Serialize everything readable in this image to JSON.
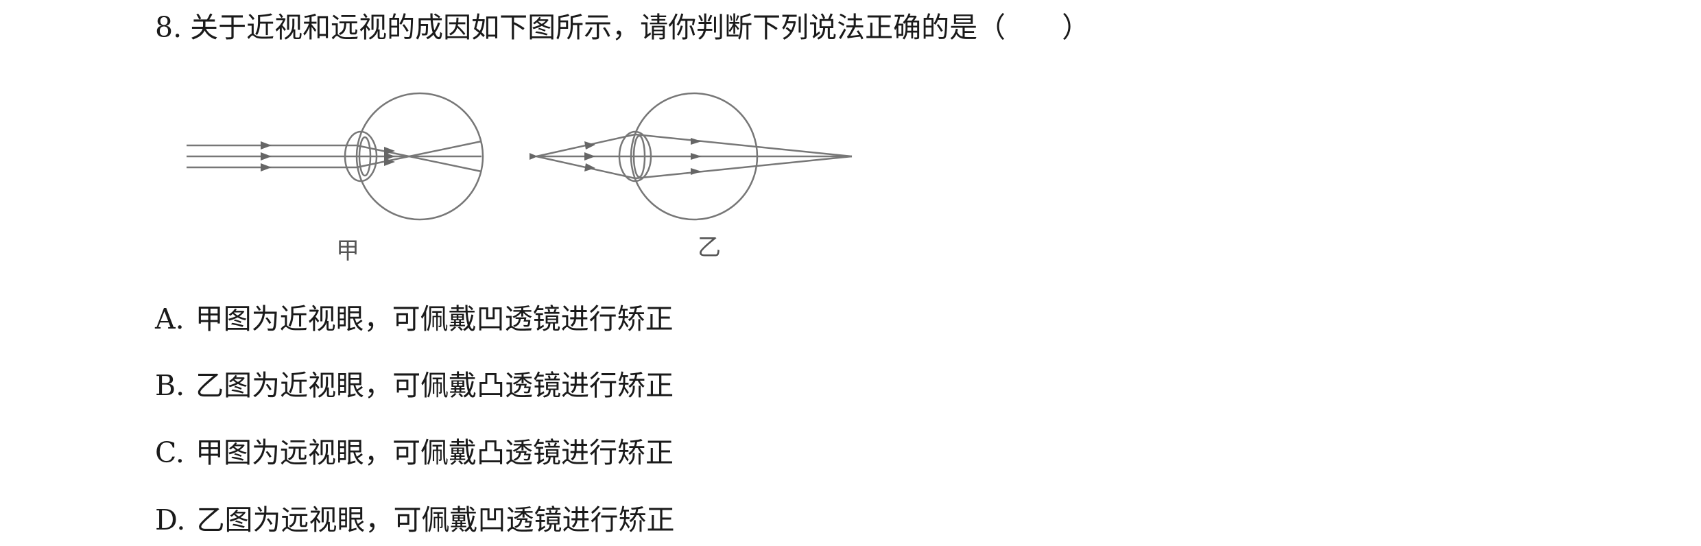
{
  "question": {
    "number": "8.",
    "text": "关于近视和远视的成因如下图所示，请你判断下列说法正确的是（　　）"
  },
  "figure": {
    "left_label": "甲",
    "right_label": "乙"
  },
  "options": [
    {
      "letter": "A.",
      "text": "甲图为近视眼，可佩戴凹透镜进行矫正"
    },
    {
      "letter": "B.",
      "text": "乙图为近视眼，可佩戴凸透镜进行矫正"
    },
    {
      "letter": "C.",
      "text": "甲图为远视眼，可佩戴凸透镜进行矫正"
    },
    {
      "letter": "D.",
      "text": "乙图为远视眼，可佩戴凹透镜进行矫正"
    }
  ]
}
